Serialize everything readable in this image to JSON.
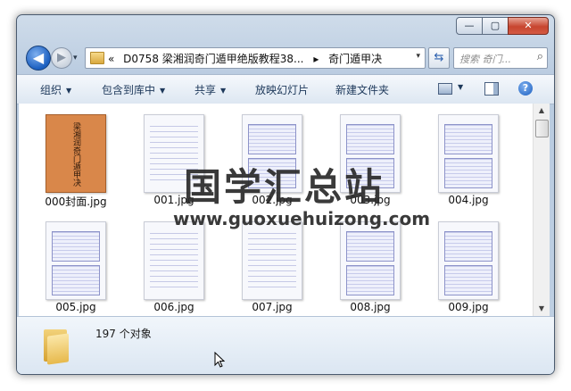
{
  "window": {
    "controls": {
      "minimize": "—",
      "maximize": "▢",
      "close": "✕"
    }
  },
  "nav": {
    "back_glyph": "◀",
    "forward_glyph": "▶",
    "history_glyph": "▾",
    "address": {
      "prefix": "«",
      "segment1": "D0758 梁湘润奇门遁甲绝版教程38...",
      "separator": "▸",
      "segment2": "奇门遁甲决",
      "dropdown": "▾"
    },
    "refresh_glyph": "⇆",
    "search_placeholder": "搜索 奇门...",
    "search_glyph": "⌕"
  },
  "toolbar": {
    "organize": "组织",
    "include_library": "包含到库中",
    "share": "共享",
    "slideshow": "放映幻灯片",
    "new_folder": "新建文件夹",
    "caret": "▼",
    "help": "?"
  },
  "files": [
    {
      "label": "000封面.jpg",
      "thumb": "cover",
      "cover_text": "梁湘润奇门遁甲决"
    },
    {
      "label": "001.jpg",
      "thumb": "text"
    },
    {
      "label": "002.jpg",
      "thumb": "blocks"
    },
    {
      "label": "003.jpg",
      "thumb": "blocks"
    },
    {
      "label": "004.jpg",
      "thumb": "blocks"
    },
    {
      "label": "005.jpg",
      "thumb": "blocks"
    },
    {
      "label": "006.jpg",
      "thumb": "text"
    },
    {
      "label": "007.jpg",
      "thumb": "text"
    },
    {
      "label": "008.jpg",
      "thumb": "blocks"
    },
    {
      "label": "009.jpg",
      "thumb": "blocks"
    }
  ],
  "watermark": {
    "title": "国学汇总站",
    "url": "www.guoxuehuizong.com"
  },
  "scrollbar": {
    "up": "▲",
    "down": "▼"
  },
  "details": {
    "count_text": "197 个对象"
  },
  "colors": {
    "cover": "#d9874a",
    "toolbar_text": "#1e395b",
    "window_frame": "#b9cbe0"
  }
}
